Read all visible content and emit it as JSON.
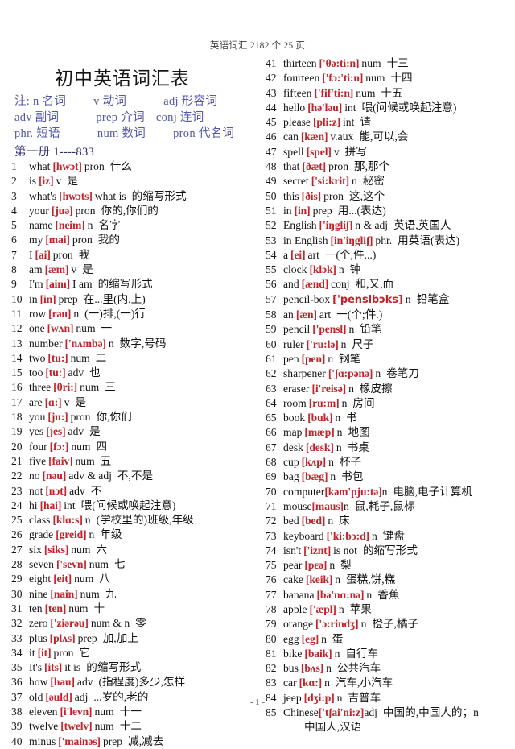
{
  "header": {
    "running_head": "英语词汇 2182 个  25 页"
  },
  "title_block": {
    "title": "初中英语词汇表",
    "legend": [
      {
        "a": "注: n 名词",
        "b": "v 动词",
        "c": "adj 形容词"
      },
      {
        "a": "adv 副词",
        "b": "prep 介词",
        "c": "conj 连词"
      },
      {
        "a": "phr. 短语",
        "b": "num 数词",
        "c": "pron 代名词"
      }
    ],
    "volume": "第一册 1----833"
  },
  "footer": {
    "page_number": "- 1 -"
  },
  "colors": {
    "phonetic": "#c0232a",
    "legend": "#5358a8",
    "text": "#141414"
  },
  "entries_left": [
    {
      "num": "1",
      "word": "what",
      "phon": "[hwɔt]",
      "pos": "pron",
      "cn": "什么"
    },
    {
      "num": "2",
      "word": "is",
      "phon": "[iz]",
      "pos": "v",
      "cn": "是"
    },
    {
      "num": "3",
      "word": "what's",
      "phon": "[hwɔts]",
      "pos": "what is",
      "cn": "的缩写形式"
    },
    {
      "num": "4",
      "word": "your",
      "phon": "[juə]",
      "pos": "pron",
      "cn": "你的,你们的"
    },
    {
      "num": "5",
      "word": "name",
      "phon": "[neim]",
      "pos": "n",
      "cn": "名字"
    },
    {
      "num": "6",
      "word": "my",
      "phon": "[mai]",
      "pos": "pron",
      "cn": "我的"
    },
    {
      "num": "7",
      "word": "I",
      "phon": "[ai]",
      "pos": "pron",
      "cn": "我"
    },
    {
      "num": "8",
      "word": "am",
      "phon": "[æm]",
      "pos": "v",
      "cn": "是"
    },
    {
      "num": "9",
      "word": "I'm",
      "phon": "[aim]",
      "pos": "I am",
      "cn": "的缩写形式"
    },
    {
      "num": "10",
      "word": "in",
      "phon": "[in]",
      "pos": "prep",
      "cn": "在...里(内,上)"
    },
    {
      "num": "11",
      "word": "row",
      "phon": "[rəu]",
      "pos": "n",
      "cn": "(一)排,(一)行"
    },
    {
      "num": "12",
      "word": "one",
      "phon": "[wʌn]",
      "pos": "num",
      "cn": "一"
    },
    {
      "num": "13",
      "word": "number",
      "phon": "['nʌmbə]",
      "pos": "n",
      "cn": "数字,号码"
    },
    {
      "num": "14",
      "word": "two",
      "phon": "[tu:]",
      "pos": "num",
      "cn": "二"
    },
    {
      "num": "15",
      "word": "too",
      "phon": "[tu:]",
      "pos": "adv",
      "cn": "也"
    },
    {
      "num": "16",
      "word": "three",
      "phon": "[θri:]",
      "pos": "num",
      "cn": "三"
    },
    {
      "num": "17",
      "word": "are",
      "phon": "[ɑ:]",
      "pos": "v",
      "cn": "是"
    },
    {
      "num": "18",
      "word": "you",
      "phon": "[ju:]",
      "pos": "pron",
      "cn": "你,你们"
    },
    {
      "num": "19",
      "word": "yes",
      "phon": "[jes]",
      "pos": "adv",
      "cn": "是"
    },
    {
      "num": "20",
      "word": "four",
      "phon": "[fɔ:]",
      "pos": "num",
      "cn": "四"
    },
    {
      "num": "21",
      "word": "five",
      "phon": "[faiv]",
      "pos": "num",
      "cn": "五"
    },
    {
      "num": "22",
      "word": "no",
      "phon": "[nəu]",
      "pos": "adv & adj",
      "cn": "不,不是"
    },
    {
      "num": "23",
      "word": "not",
      "phon": "[nɔt]",
      "pos": "adv",
      "cn": "不"
    },
    {
      "num": "24",
      "word": "hi",
      "phon": "[hai]",
      "pos": "int",
      "cn": "喂(问候或唤起注意)"
    },
    {
      "num": "25",
      "word": "class",
      "phon": "[klɑ:s]",
      "pos": "n",
      "cn": "(学校里的)班级,年级"
    },
    {
      "num": "26",
      "word": "grade",
      "phon": "[greid]",
      "pos": "n",
      "cn": "年级"
    },
    {
      "num": "27",
      "word": "six",
      "phon": "[siks]",
      "pos": "num",
      "cn": "六"
    },
    {
      "num": "28",
      "word": "seven",
      "phon": "['sevn]",
      "pos": "num",
      "cn": "七"
    },
    {
      "num": "29",
      "word": "eight",
      "phon": "[eit]",
      "pos": "num",
      "cn": "八"
    },
    {
      "num": "30",
      "word": "nine",
      "phon": "[nain]",
      "pos": "num",
      "cn": "九"
    },
    {
      "num": "31",
      "word": "ten",
      "phon": "[ten]",
      "pos": "num",
      "cn": "十"
    },
    {
      "num": "32",
      "word": "zero",
      "phon": "['ziərəu]",
      "pos": "num & n",
      "cn": "零"
    },
    {
      "num": "33",
      "word": "plus",
      "phon": "[plʌs]",
      "pos": "prep",
      "cn": "加,加上"
    },
    {
      "num": "34",
      "word": "it",
      "phon": "[it]",
      "pos": "pron",
      "cn": "它"
    },
    {
      "num": "35",
      "word": "It's",
      "phon": "[its]",
      "pos": "it is",
      "cn": "的缩写形式"
    },
    {
      "num": "36",
      "word": "how",
      "phon": "[hau]",
      "pos": "adv",
      "cn": "(指程度)多少,怎样"
    },
    {
      "num": "37",
      "word": "old",
      "phon": "[əuld]",
      "pos": "adj",
      "cn": "...岁的,老的"
    },
    {
      "num": "38",
      "word": "eleven",
      "phon": "[i'levn]",
      "pos": "num",
      "cn": "十一"
    },
    {
      "num": "39",
      "word": "twelve",
      "phon": "[twelv]",
      "pos": "num",
      "cn": "十二"
    },
    {
      "num": "40",
      "word": "minus",
      "phon": "['mainəs]",
      "pos": "prep",
      "cn": "减,减去"
    }
  ],
  "entries_right": [
    {
      "num": "41",
      "word": "thirteen",
      "phon": "['θə:ti:n]",
      "pos": "num",
      "cn": "十三"
    },
    {
      "num": "42",
      "word": "fourteen",
      "phon": "['fɔ:'ti:n]",
      "pos": "num",
      "cn": "十四"
    },
    {
      "num": "43",
      "word": "fifteen",
      "phon": "['fif'ti:n]",
      "pos": "num",
      "cn": "十五"
    },
    {
      "num": "44",
      "word": "hello",
      "phon": "[hə'ləu]",
      "pos": "int",
      "cn": "喂(问候或唤起注意)"
    },
    {
      "num": "45",
      "word": "please",
      "phon": "[pli:z]",
      "pos": "int",
      "cn": "请"
    },
    {
      "num": "46",
      "word": "can",
      "phon": "[kæn]",
      "pos": "v.aux",
      "cn": "能,可以,会"
    },
    {
      "num": "47",
      "word": "spell",
      "phon": "[spel]",
      "pos": "v",
      "cn": "拼写"
    },
    {
      "num": "48",
      "word": "that",
      "phon": "[ðæt]",
      "pos": "pron",
      "cn": "那,那个"
    },
    {
      "num": "49",
      "word": "secret",
      "phon": "['si:krit]",
      "pos": "n",
      "cn": "秘密"
    },
    {
      "num": "50",
      "word": "this",
      "phon": "[ðis]",
      "pos": "pron",
      "cn": "这,这个"
    },
    {
      "num": "51",
      "word": "in",
      "phon": "[in]",
      "pos": "prep",
      "cn": "用...(表达)"
    },
    {
      "num": "52",
      "word": "English",
      "phon": "['iŋgliʃ]",
      "pos": "n & adj",
      "cn": "英语,英国人"
    },
    {
      "num": "53",
      "word": "in English",
      "phon": "[in'iŋgliʃ]",
      "pos": "phr.",
      "cn": "用英语(表达)"
    },
    {
      "num": "54",
      "word": "a",
      "phon": "[ei]",
      "pos": "art",
      "cn": "一(个,件...)"
    },
    {
      "num": "55",
      "word": "clock",
      "phon": "[klɔk]",
      "pos": "n",
      "cn": "钟"
    },
    {
      "num": "56",
      "word": "and",
      "phon": "[ænd]",
      "pos": "conj",
      "cn": "和,又,而"
    },
    {
      "num": "57",
      "word": "pencil-box",
      "phon": "['penslbɔks]",
      "pos": "n",
      "cn": "铅笔盒",
      "phon_sans": true
    },
    {
      "num": "58",
      "word": "an",
      "phon": "[æn]",
      "pos": "art",
      "cn": "一(个;件.)"
    },
    {
      "num": "59",
      "word": "pencil",
      "phon": "['pensl]",
      "pos": "n",
      "cn": "铅笔"
    },
    {
      "num": "60",
      "word": "ruler",
      "phon": "['ru:lə]",
      "pos": "n",
      "cn": "尺子"
    },
    {
      "num": "61",
      "word": "pen",
      "phon": "[pen]",
      "pos": "n",
      "cn": "钢笔"
    },
    {
      "num": "62",
      "word": "sharpener",
      "phon": "['ʃɑ:pənə]",
      "pos": "n",
      "cn": "卷笔刀"
    },
    {
      "num": "63",
      "word": "eraser",
      "phon": "[i'reisə]",
      "pos": "n",
      "cn": "橡皮擦"
    },
    {
      "num": "64",
      "word": "room",
      "phon": "[ru:m]",
      "pos": "n",
      "cn": "房间"
    },
    {
      "num": "65",
      "word": "book",
      "phon": "[buk]",
      "pos": "n",
      "cn": "书"
    },
    {
      "num": "66",
      "word": "map",
      "phon": "[mæp]",
      "pos": "n",
      "cn": "地图"
    },
    {
      "num": "67",
      "word": "desk",
      "phon": "[desk]",
      "pos": "n",
      "cn": "书桌"
    },
    {
      "num": "68",
      "word": "cup",
      "phon": "[kʌp]",
      "pos": "n",
      "cn": "杯子"
    },
    {
      "num": "69",
      "word": "bag",
      "phon": "[bæg]",
      "pos": "n",
      "cn": "书包"
    },
    {
      "num": "70",
      "word": "computer",
      "phon": "[kəm'pju:tə]",
      "pos": "n",
      "cn": "电脑,电子计算机",
      "tight": true
    },
    {
      "num": "71",
      "word": "mouse",
      "phon": "[maus]",
      "pos": "n",
      "cn": "鼠,耗子,鼠标",
      "tight": true
    },
    {
      "num": "72",
      "word": "bed",
      "phon": "[bed]",
      "pos": "n",
      "cn": "床"
    },
    {
      "num": "73",
      "word": "keyboard",
      "phon": "['ki:bɔ:d]",
      "pos": "n",
      "cn": "键盘"
    },
    {
      "num": "74",
      "word": "isn't",
      "phon": "['iznt]",
      "pos": "is not",
      "cn": "的缩写形式"
    },
    {
      "num": "75",
      "word": "pear",
      "phon": "[pɛə]",
      "pos": "n",
      "cn": "梨"
    },
    {
      "num": "76",
      "word": "cake",
      "phon": "[keik]",
      "pos": "n",
      "cn": "蛋糕,饼,糕"
    },
    {
      "num": "77",
      "word": "banana",
      "phon": "[bə'nɑ:nə]",
      "pos": "n",
      "cn": "香蕉"
    },
    {
      "num": "78",
      "word": "apple",
      "phon": "['æpl]",
      "pos": "n",
      "cn": "苹果"
    },
    {
      "num": "79",
      "word": "orange",
      "phon": "['ɔ:rindʒ]",
      "pos": "n",
      "cn": "橙子,橘子"
    },
    {
      "num": "80",
      "word": "egg",
      "phon": "[eg]",
      "pos": "n",
      "cn": "蛋"
    },
    {
      "num": "81",
      "word": "bike",
      "phon": "[baik]",
      "pos": "n",
      "cn": "自行车"
    },
    {
      "num": "82",
      "word": "bus",
      "phon": "[bʌs]",
      "pos": "n",
      "cn": "公共汽车"
    },
    {
      "num": "83",
      "word": "car",
      "phon": "[kɑ:]",
      "pos": "n",
      "cn": "汽车,小汽车"
    },
    {
      "num": "84",
      "word": "jeep",
      "phon": "[dʒi:p]",
      "pos": "n",
      "cn": "吉普车"
    },
    {
      "num": "85",
      "word": "Chinese",
      "phon": "['tʃai'ni:z]",
      "pos": "adj",
      "cn": "中国的,中国人的；n",
      "tight": true,
      "continuation": "中国人,汉语"
    }
  ]
}
